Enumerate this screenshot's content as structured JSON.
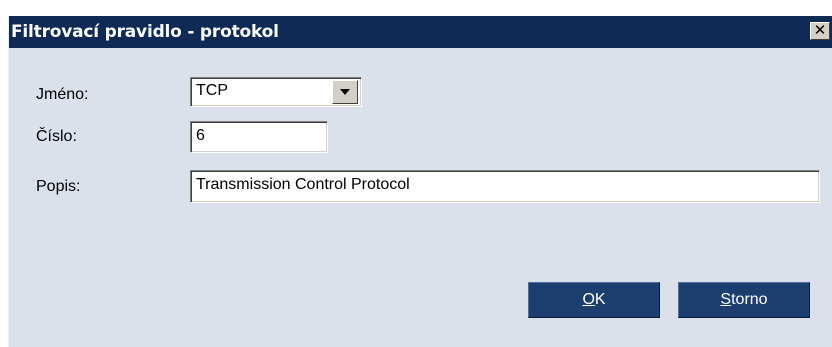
{
  "window": {
    "title": "Filtrovací pravidlo - protokol",
    "close_glyph": "✕"
  },
  "form": {
    "name_label": "Jméno:",
    "name_value": "TCP",
    "number_label": "Číslo:",
    "number_value": "6",
    "description_label": "Popis:",
    "description_value": "Transmission Control Protocol"
  },
  "buttons": {
    "ok_accel": "O",
    "ok_rest": "K",
    "cancel_accel": "S",
    "cancel_rest": "torno"
  },
  "icons": {
    "close": "close-icon",
    "dropdown": "chevron-down-icon"
  },
  "colors": {
    "titlebar": "#0f2b55",
    "dialog_bg": "#dbe1ea",
    "button_bg": "#1d3f70"
  }
}
